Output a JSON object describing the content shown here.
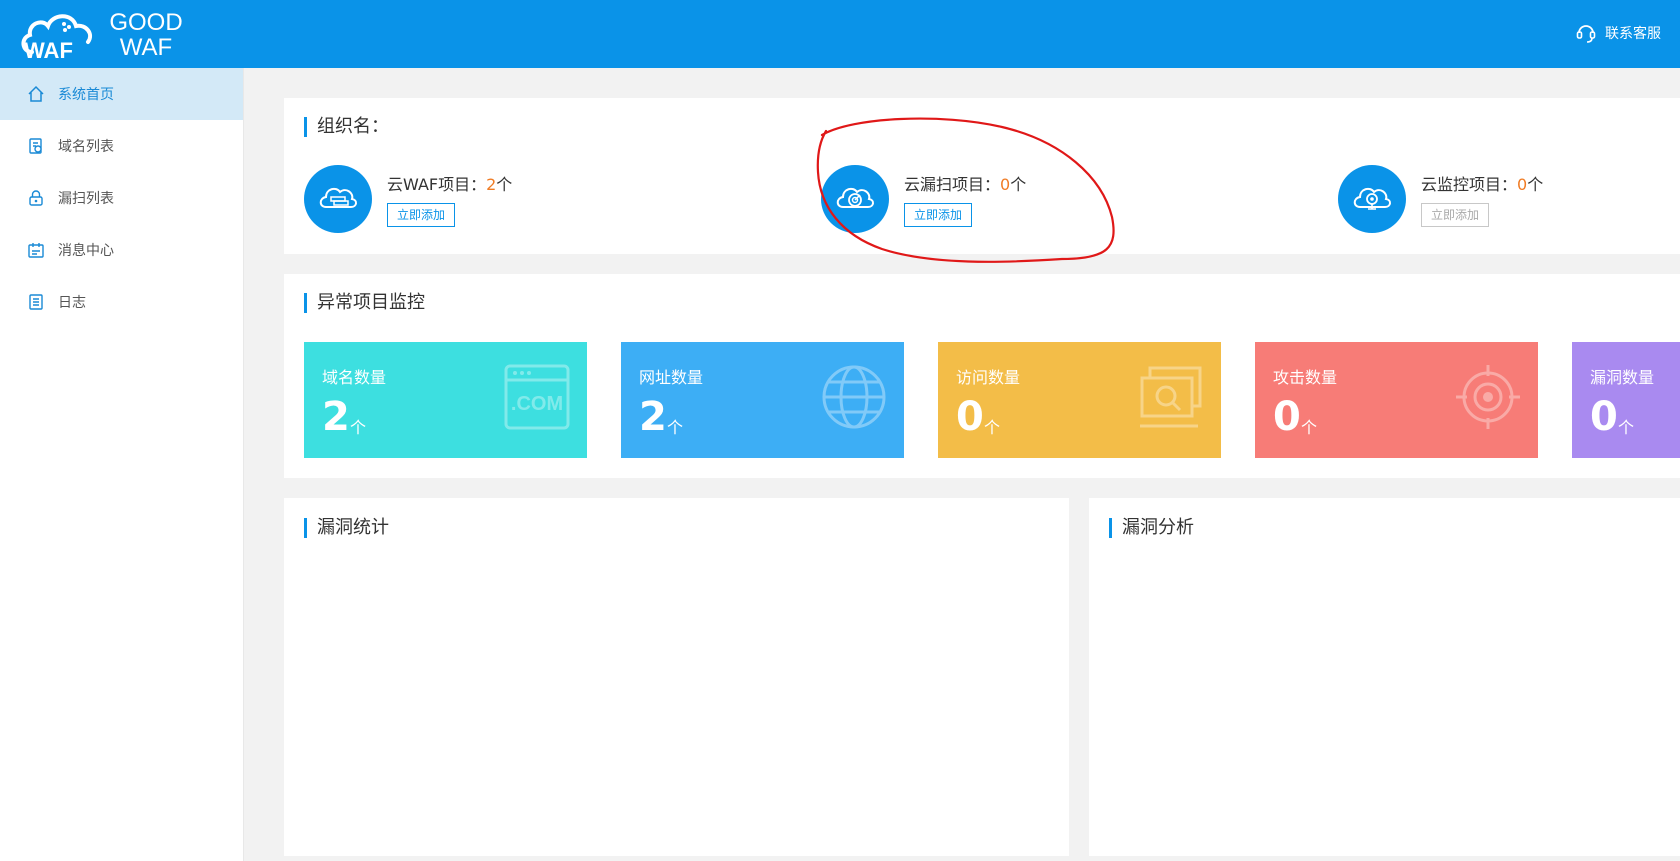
{
  "header": {
    "logo_line1": "GOOD",
    "logo_line2": "WAF",
    "logo_mark": "WAF",
    "contact_label": "联系客服",
    "background": "#0a93e8"
  },
  "sidebar": {
    "items": [
      {
        "label": "系统首页",
        "icon": "home-icon",
        "active": true
      },
      {
        "label": "域名列表",
        "icon": "domain-list-icon",
        "active": false
      },
      {
        "label": "漏扫列表",
        "icon": "lock-icon",
        "active": false
      },
      {
        "label": "消息中心",
        "icon": "message-icon",
        "active": false
      },
      {
        "label": "日志",
        "icon": "log-icon",
        "active": false
      }
    ]
  },
  "org": {
    "title": "组织名：",
    "projects": [
      {
        "name": "云WAF项目：",
        "count": "2",
        "unit": "个",
        "button": "立即添加",
        "icon": "cloud-waf-icon"
      },
      {
        "name": "云漏扫项目：",
        "count": "0",
        "unit": "个",
        "button": "立即添加",
        "icon": "cloud-scan-icon"
      },
      {
        "name": "云监控项目：",
        "count": "0",
        "unit": "个",
        "button": "立即添加",
        "icon": "cloud-monitor-icon"
      }
    ]
  },
  "monitor": {
    "title": "异常项目监控",
    "tiles": [
      {
        "label": "域名数量",
        "value": "2",
        "unit": "个",
        "color": "#3ddfe0",
        "icon": "dotcom-icon",
        "icon_text": ".COM"
      },
      {
        "label": "网址数量",
        "value": "2",
        "unit": "个",
        "color": "#3daef5",
        "icon": "globe-icon"
      },
      {
        "label": "访问数量",
        "value": "0",
        "unit": "个",
        "color": "#f3bd48",
        "icon": "search-screen-icon"
      },
      {
        "label": "攻击数量",
        "value": "0",
        "unit": "个",
        "color": "#f77c77",
        "icon": "target-icon"
      },
      {
        "label": "漏洞数量",
        "value": "0",
        "unit": "个",
        "color": "#a98af0",
        "icon": "bug-icon"
      }
    ]
  },
  "stats": {
    "title": "漏洞统计"
  },
  "analysis": {
    "title": "漏洞分析"
  },
  "annotation": {
    "color": "#e01818"
  }
}
